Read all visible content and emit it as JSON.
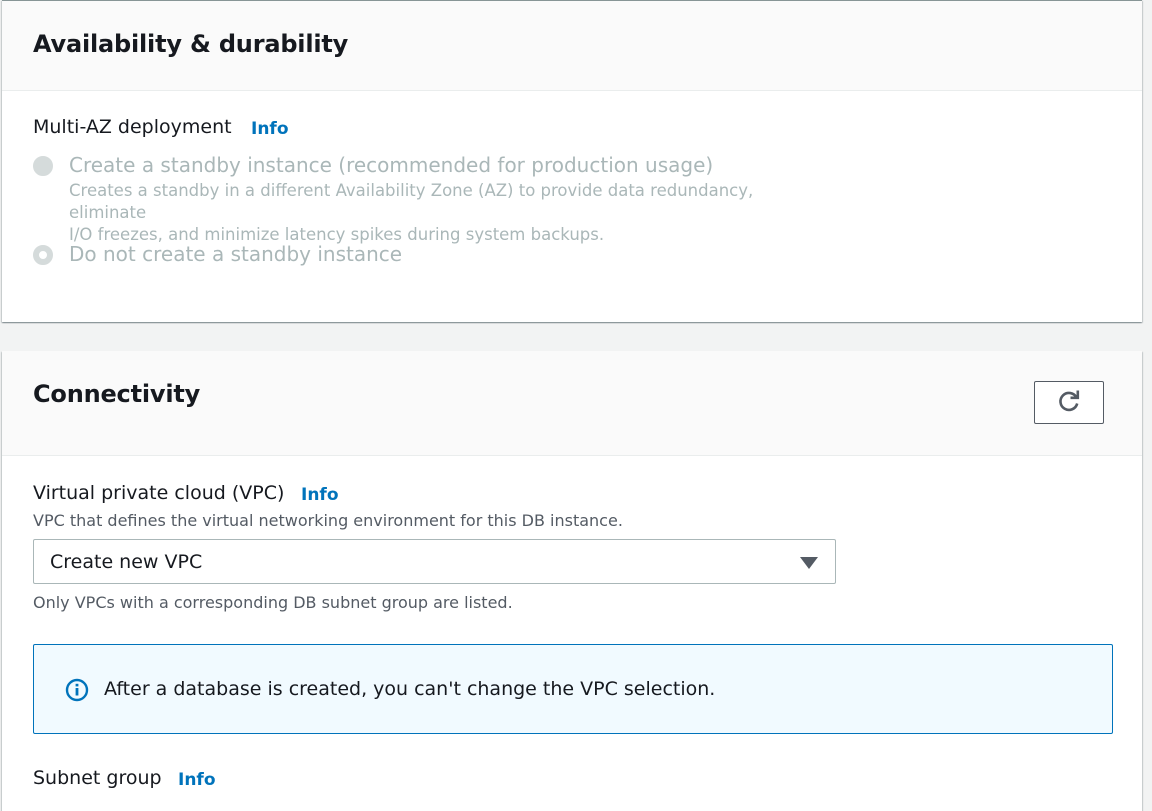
{
  "availability": {
    "title": "Availability & durability",
    "multi_az_label": "Multi-AZ deployment",
    "info_label": "Info",
    "options": [
      {
        "label": "Create a standby instance (recommended for production usage)",
        "description_line1": "Creates a standby in a different Availability Zone (AZ) to provide data redundancy, eliminate",
        "description_line2": "I/O freezes, and minimize latency spikes during system backups.",
        "selected": false
      },
      {
        "label": "Do not create a standby instance",
        "selected": true
      }
    ]
  },
  "connectivity": {
    "title": "Connectivity",
    "refresh_icon": "refresh-icon",
    "vpc": {
      "label": "Virtual private cloud (VPC)",
      "info_label": "Info",
      "description": "VPC that defines the virtual networking environment for this DB instance.",
      "selected_value": "Create new VPC",
      "hint": "Only VPCs with a corresponding DB subnet group are listed."
    },
    "alert": {
      "icon": "info-circle-icon",
      "text": "After a database is created, you can't change the VPC selection."
    },
    "subnet_group": {
      "label": "Subnet group",
      "info_label": "Info"
    }
  },
  "colors": {
    "link": "#0073bb",
    "disabled": "#aab7b8",
    "alert_bg": "#f1faff",
    "alert_border": "#0073bb"
  }
}
